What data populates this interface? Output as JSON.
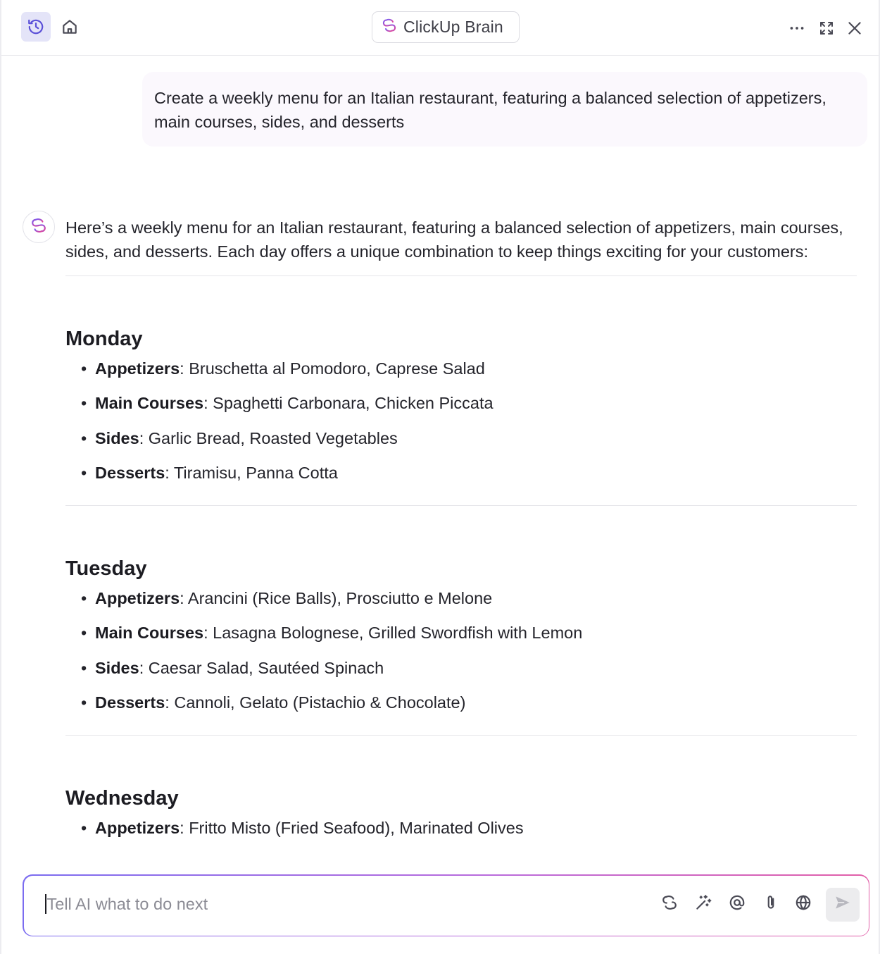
{
  "header": {
    "title": "ClickUp Brain",
    "icons": [
      "history-icon",
      "home-icon",
      "more-icon",
      "expand-icon",
      "close-icon"
    ]
  },
  "conversation": {
    "user_prompt": "Create a weekly menu for an Italian restaurant, featuring a balanced selection of appetizers, main courses, sides, and desserts",
    "ai_intro": "Here’s a weekly menu for an Italian restaurant, featuring a balanced selection of appetizers, main courses, sides, and desserts. Each day offers a unique combination to keep things exciting for your customers:",
    "days": [
      {
        "name": "Monday",
        "items": [
          {
            "label": "Appetizers",
            "text": ": Bruschetta al Pomodoro, Caprese Salad"
          },
          {
            "label": "Main Courses",
            "text": ": Spaghetti Carbonara, Chicken Piccata"
          },
          {
            "label": "Sides",
            "text": ": Garlic Bread, Roasted Vegetables"
          },
          {
            "label": "Desserts",
            "text": ": Tiramisu, Panna Cotta"
          }
        ]
      },
      {
        "name": "Tuesday",
        "items": [
          {
            "label": "Appetizers",
            "text": ": Arancini (Rice Balls), Prosciutto e Melone"
          },
          {
            "label": "Main Courses",
            "text": ": Lasagna Bolognese, Grilled Swordfish with Lemon"
          },
          {
            "label": "Sides",
            "text": ": Caesar Salad, Sautéed Spinach"
          },
          {
            "label": "Desserts",
            "text": ": Cannoli, Gelato (Pistachio & Chocolate)"
          }
        ]
      },
      {
        "name": "Wednesday",
        "items": [
          {
            "label": "Appetizers",
            "text": ": Fritto Misto (Fried Seafood), Marinated Olives"
          }
        ]
      }
    ]
  },
  "composer": {
    "placeholder": "Tell AI what to do next",
    "tools": [
      "brain-icon",
      "magic-wand-icon",
      "mention-icon",
      "attachment-icon",
      "globe-icon",
      "send-icon"
    ]
  },
  "colors": {
    "accent": "#5a4fd8",
    "brand_gradient_start": "#7b6cf0",
    "brand_gradient_end": "#e25fa8",
    "user_bubble": "#fbf8fd"
  }
}
